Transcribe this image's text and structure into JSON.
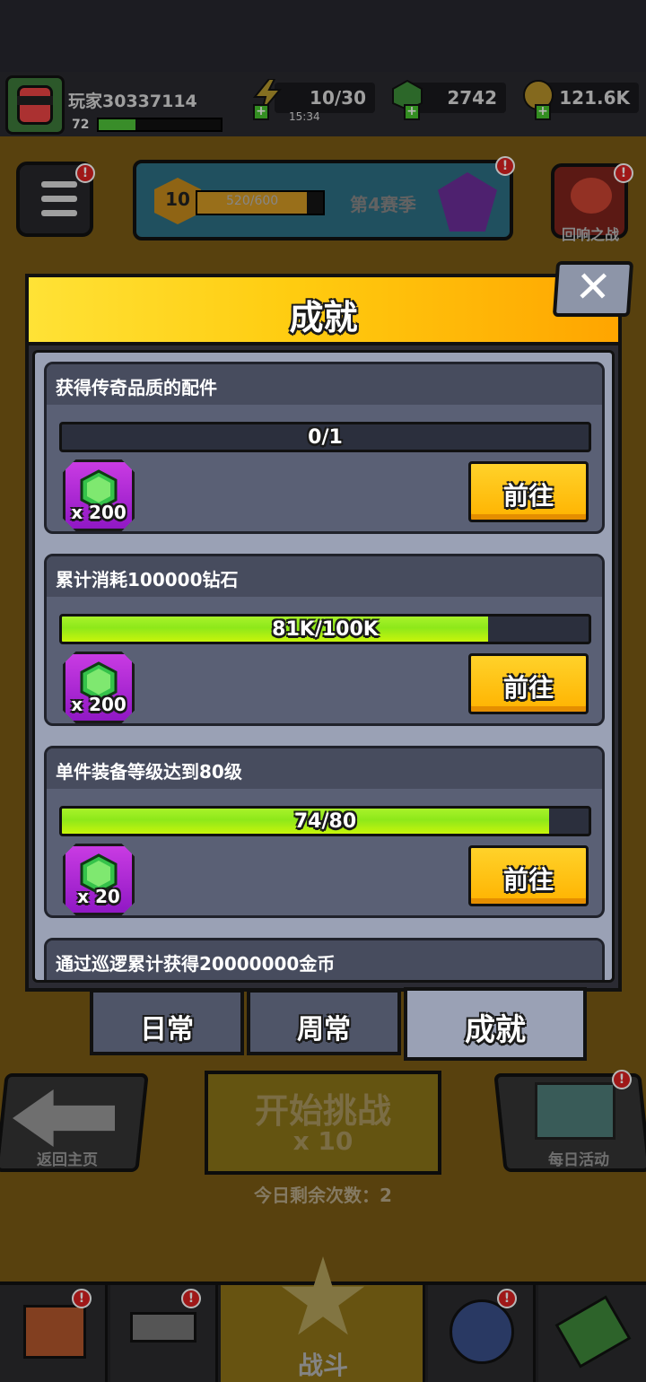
{
  "hud": {
    "player_name": "玩家30337114",
    "level": "72",
    "level_progress": 0.3,
    "energy": "10/30",
    "energy_timer": "15:34",
    "gems": "2742",
    "coins": "121.6K"
  },
  "season": {
    "level": "10",
    "xp": "520/600",
    "xp_progress": 0.87,
    "title": "第4赛季"
  },
  "echo_battle_label": "回响之战",
  "modal": {
    "title": "成就",
    "close_icon": "✕",
    "cards": [
      {
        "title": "获得传奇品质的配件",
        "progress_text": "0/1",
        "progress": 0.0,
        "reward_qty": "x 200",
        "button": "前往"
      },
      {
        "title": "累计消耗100000钻石",
        "progress_text": "81K/100K",
        "progress": 0.81,
        "reward_qty": "x 200",
        "button": "前往"
      },
      {
        "title": "单件装备等级达到80级",
        "progress_text": "74/80",
        "progress": 0.925,
        "reward_qty": "x 20",
        "button": "前往"
      },
      {
        "title": "通过巡逻累计获得20000000金币"
      }
    ],
    "tabs": [
      {
        "label": "日常",
        "active": false
      },
      {
        "label": "周常",
        "active": false
      },
      {
        "label": "成就",
        "active": true
      }
    ]
  },
  "bottom": {
    "back_label": "返回主页",
    "start_title": "开始挑战",
    "start_cost": "x 10",
    "remaining": "今日剩余次数：2",
    "daily_label": "每日活动",
    "battle_label": "战斗"
  },
  "badge_mark": "!",
  "colors": {
    "header_yellow": "#ffcc10",
    "go_button": "#ffb300",
    "progress_green": "#a8f22a",
    "reward_purple": "#b02ad6",
    "card_bg": "#5a6075"
  }
}
